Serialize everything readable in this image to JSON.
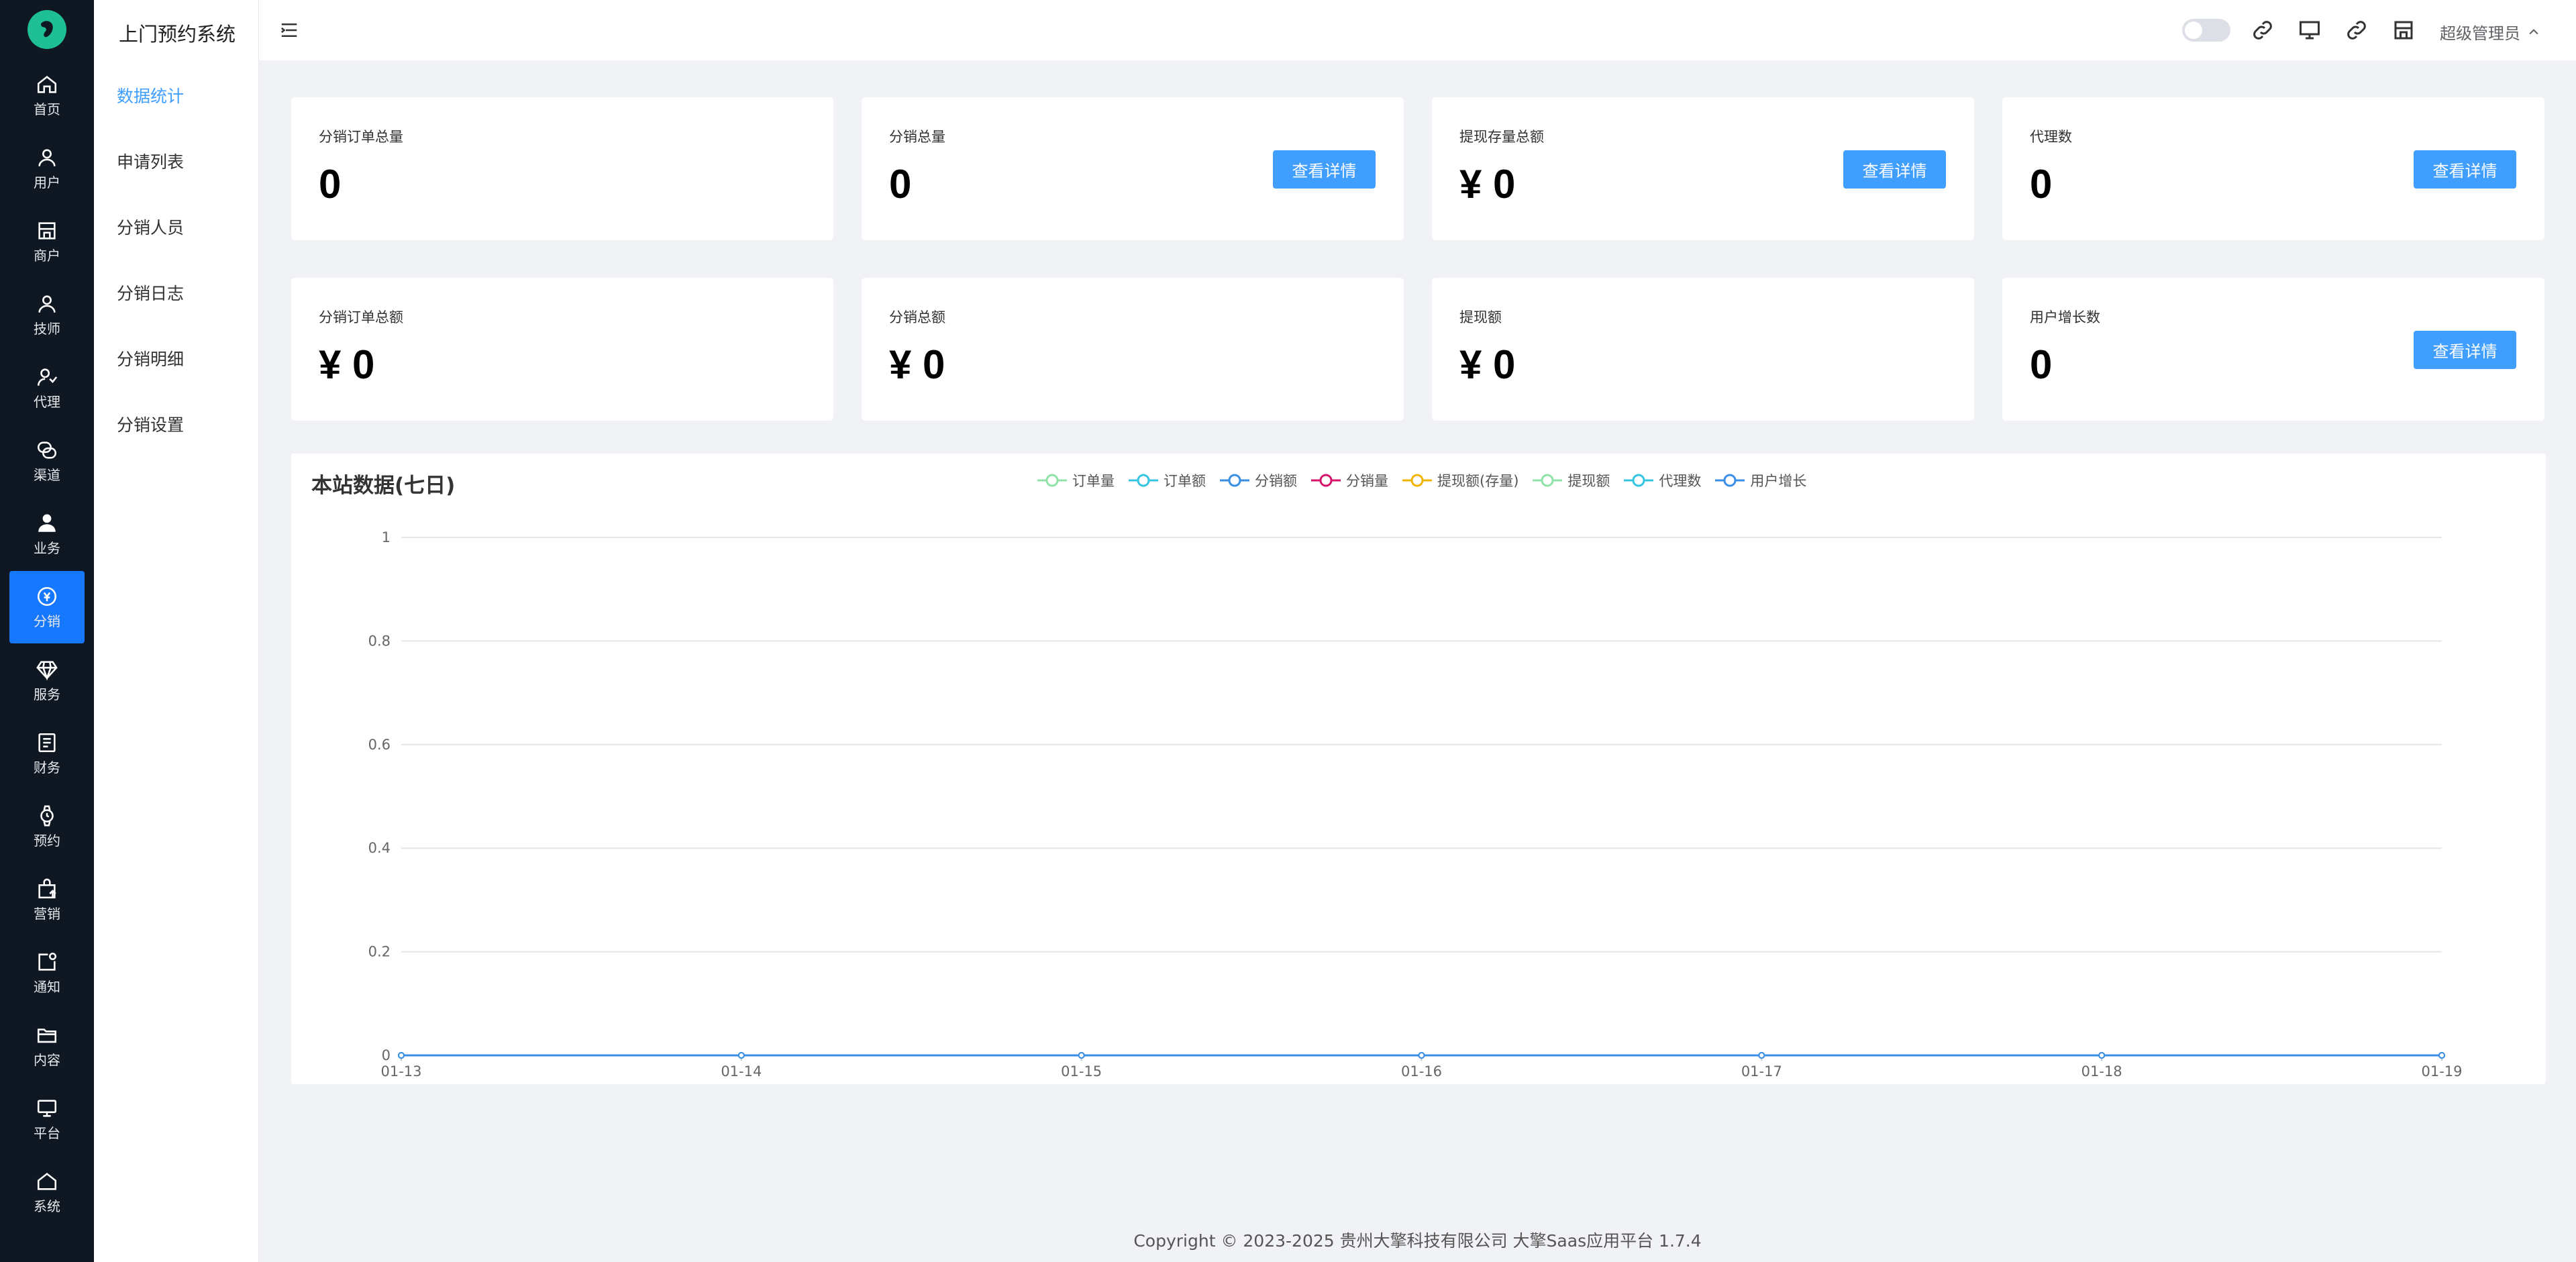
{
  "app": {
    "title": "上门预约系统"
  },
  "rail": [
    {
      "label": "首页",
      "icon": "home-icon"
    },
    {
      "label": "用户",
      "icon": "user-icon"
    },
    {
      "label": "商户",
      "icon": "store-icon"
    },
    {
      "label": "技师",
      "icon": "technician-icon"
    },
    {
      "label": "代理",
      "icon": "agent-icon"
    },
    {
      "label": "渠道",
      "icon": "channel-icon"
    },
    {
      "label": "业务",
      "icon": "business-icon"
    },
    {
      "label": "分销",
      "icon": "distribution-icon",
      "active": true
    },
    {
      "label": "服务",
      "icon": "diamond-icon"
    },
    {
      "label": "财务",
      "icon": "ledger-icon"
    },
    {
      "label": "预约",
      "icon": "watch-icon"
    },
    {
      "label": "营销",
      "icon": "marketing-bag-icon"
    },
    {
      "label": "通知",
      "icon": "notification-icon"
    },
    {
      "label": "内容",
      "icon": "folder-icon"
    },
    {
      "label": "平台",
      "icon": "monitor-icon"
    },
    {
      "label": "系统",
      "icon": "system-home-icon"
    }
  ],
  "submenu": [
    {
      "label": "数据统计",
      "active": true
    },
    {
      "label": "申请列表"
    },
    {
      "label": "分销人员"
    },
    {
      "label": "分销日志"
    },
    {
      "label": "分销明细"
    },
    {
      "label": "分销设置"
    }
  ],
  "header": {
    "user": "超级管理员"
  },
  "cards": [
    {
      "title": "分销订单总量",
      "value": "0"
    },
    {
      "title": "分销总量",
      "value": "0",
      "button": "查看详情"
    },
    {
      "title": "提现存量总额",
      "value": "¥ 0",
      "button": "查看详情"
    },
    {
      "title": "代理数",
      "value": "0",
      "button": "查看详情"
    },
    {
      "title": "分销订单总额",
      "value": "¥ 0"
    },
    {
      "title": "分销总额",
      "value": "¥ 0"
    },
    {
      "title": "提现额",
      "value": "¥ 0"
    },
    {
      "title": "用户增长数",
      "value": "0",
      "button": "查看详情"
    }
  ],
  "colors": {
    "primary": "#409eff",
    "rail_bg": "#0f1723",
    "rail_active": "#1677ff"
  },
  "chart_data": {
    "type": "line",
    "title": "本站数据(七日)",
    "categories": [
      "01-13",
      "01-14",
      "01-15",
      "01-16",
      "01-17",
      "01-18",
      "01-19"
    ],
    "ylim": [
      0,
      1
    ],
    "yticks": [
      "0",
      "0.2",
      "0.4",
      "0.6",
      "0.8",
      "1"
    ],
    "grid": true,
    "legend_position": "top-center",
    "series": [
      {
        "name": "订单量",
        "color": "#91e2a8",
        "values": [
          0,
          0,
          0,
          0,
          0,
          0,
          0
        ]
      },
      {
        "name": "订单额",
        "color": "#36c5e0",
        "values": [
          0,
          0,
          0,
          0,
          0,
          0,
          0
        ]
      },
      {
        "name": "分销额",
        "color": "#3a8ee6",
        "values": [
          0,
          0,
          0,
          0,
          0,
          0,
          0
        ]
      },
      {
        "name": "分销量",
        "color": "#d6136a",
        "values": [
          0,
          0,
          0,
          0,
          0,
          0,
          0
        ]
      },
      {
        "name": "提现额(存量)",
        "color": "#f0b400",
        "values": [
          0,
          0,
          0,
          0,
          0,
          0,
          0
        ]
      },
      {
        "name": "提现额",
        "color": "#91e2a8",
        "values": [
          0,
          0,
          0,
          0,
          0,
          0,
          0
        ]
      },
      {
        "name": "代理数",
        "color": "#36c5e0",
        "values": [
          0,
          0,
          0,
          0,
          0,
          0,
          0
        ]
      },
      {
        "name": "用户增长",
        "color": "#3a8ee6",
        "values": [
          0,
          0,
          0,
          0,
          0,
          0,
          0
        ]
      }
    ]
  },
  "footer": {
    "text": "Copyright © 2023-2025 贵州大擎科技有限公司   大擎Saas应用平台 1.7.4"
  }
}
